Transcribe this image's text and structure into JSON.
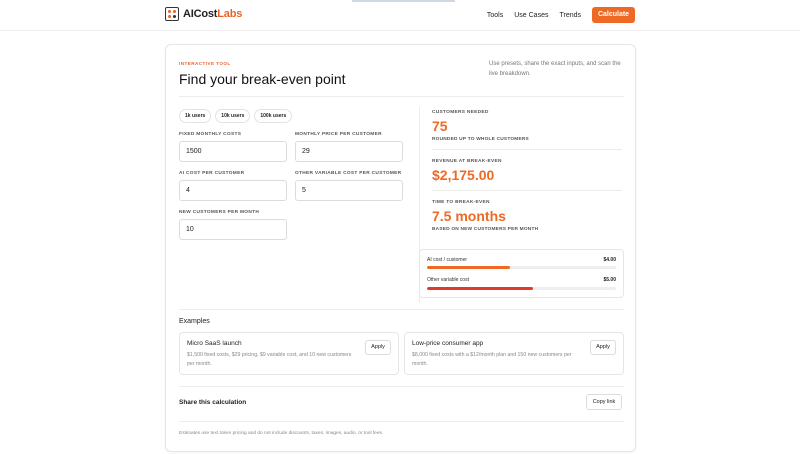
{
  "header": {
    "logo_prefix": "AI",
    "logo_main": "Cost",
    "logo_accent": "Labs",
    "nav": [
      "Tools",
      "Use Cases",
      "Trends"
    ],
    "cta": "Calculate"
  },
  "hero": {
    "eyebrow": "INTERACTIVE TOOL",
    "title": "Find your break-even point",
    "intro": "Use presets, share the exact inputs, and scan the live breakdown."
  },
  "presets": [
    "1k users",
    "10k users",
    "100k users"
  ],
  "inputs": {
    "fixed_costs": {
      "label": "FIXED MONTHLY COSTS",
      "value": "1500"
    },
    "price": {
      "label": "MONTHLY PRICE PER CUSTOMER",
      "value": "29"
    },
    "ai_cost": {
      "label": "AI COST PER CUSTOMER",
      "value": "4"
    },
    "other_cost": {
      "label": "OTHER VARIABLE COST PER CUSTOMER",
      "value": "5"
    },
    "new_customers": {
      "label": "NEW CUSTOMERS PER MONTH",
      "value": "10"
    }
  },
  "results": {
    "customers": {
      "label": "CUSTOMERS NEEDED",
      "value": "75",
      "sub": "ROUNDED UP TO WHOLE CUSTOMERS"
    },
    "revenue": {
      "label": "REVENUE AT BREAK-EVEN",
      "value": "$2,175.00"
    },
    "time": {
      "label": "TIME TO BREAK-EVEN",
      "value": "7.5 months",
      "sub": "BASED ON NEW CUSTOMERS PER MONTH"
    }
  },
  "breakdown": [
    {
      "label": "AI cost / customer",
      "amount": "$4.00",
      "fill_fraction": 0.44,
      "color": "#ee6a24"
    },
    {
      "label": "Other variable cost",
      "amount": "$5.00",
      "fill_fraction": 0.56,
      "color": "#e03a2f"
    }
  ],
  "examples": {
    "title": "Examples",
    "items": [
      {
        "title": "Micro SaaS launch",
        "desc": "$1,500 fixed costs, $29 pricing, $9 variable cost, and 10 new customers per month.",
        "button": "Apply"
      },
      {
        "title": "Low-price consumer app",
        "desc": "$8,000 fixed costs with a $12/month plan and 150 new customers per month.",
        "button": "Apply"
      }
    ]
  },
  "share": {
    "title": "Share this calculation",
    "button": "Copy link"
  },
  "footnote": "Estimates use text token pricing and do not include discounts, taxes, images, audio, or tool fees.",
  "colors": {
    "accent": "#ee6a24",
    "danger": "#e03a2f"
  }
}
